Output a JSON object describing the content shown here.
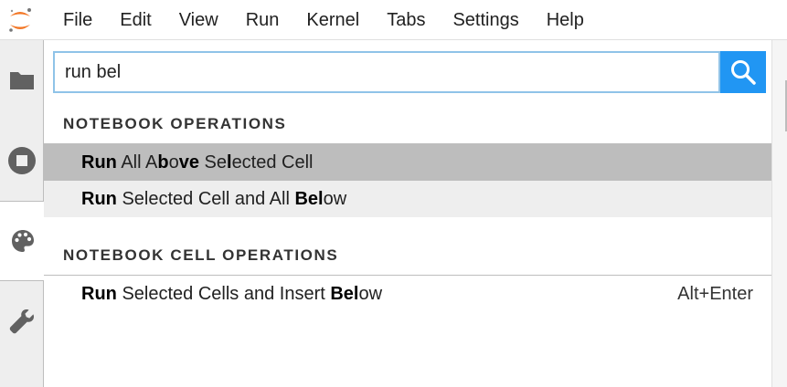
{
  "menu": [
    "File",
    "Edit",
    "View",
    "Run",
    "Kernel",
    "Tabs",
    "Settings",
    "Help"
  ],
  "sidebar": {
    "tabs": [
      {
        "icon": "folder-icon"
      },
      {
        "icon": "stop-circle-icon"
      },
      {
        "icon": "palette-icon",
        "active": true
      },
      {
        "icon": "wrench-icon"
      }
    ]
  },
  "search": {
    "value": "run bel",
    "icon": "search-icon"
  },
  "groups": [
    {
      "category": "NOTEBOOK OPERATIONS",
      "items": [
        {
          "segments": [
            [
              "Run",
              true
            ],
            [
              " All A",
              false
            ],
            [
              "b",
              true
            ],
            [
              "o",
              false
            ],
            [
              "ve",
              true
            ],
            [
              " Se",
              false
            ],
            [
              "l",
              true
            ],
            [
              "ected Cell",
              false
            ]
          ],
          "shortcut": "",
          "state": "active"
        },
        {
          "segments": [
            [
              "Run",
              true
            ],
            [
              " Selected Cell and All ",
              false
            ],
            [
              "Bel",
              true
            ],
            [
              "ow",
              false
            ]
          ],
          "shortcut": "",
          "state": "hover"
        }
      ]
    },
    {
      "category": "NOTEBOOK CELL OPERATIONS",
      "items": [
        {
          "segments": [
            [
              "Run",
              true
            ],
            [
              " Selected Cells and Insert ",
              false
            ],
            [
              "Bel",
              true
            ],
            [
              "ow",
              false
            ]
          ],
          "shortcut": "Alt+Enter",
          "state": ""
        }
      ]
    }
  ],
  "colors": {
    "accent": "#2196f3",
    "logo": "#f37726",
    "active_item": "#bdbdbd",
    "hover_item": "#eeeeee"
  }
}
